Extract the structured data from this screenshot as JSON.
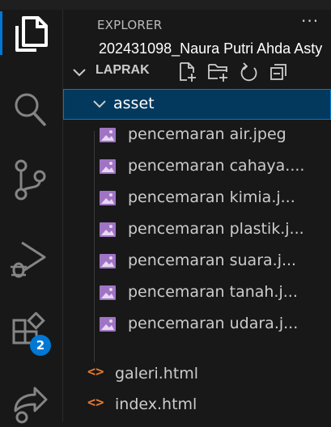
{
  "window": {
    "explorer_title": "EXPLORER",
    "more_label": "···",
    "tooltip": "202431098_Naura Putri Ahda Asty"
  },
  "activity_bar": {
    "items": [
      {
        "icon": "files-icon",
        "active": true
      },
      {
        "icon": "search-icon"
      },
      {
        "icon": "source-control-icon"
      },
      {
        "icon": "run-debug-icon"
      },
      {
        "icon": "extensions-icon",
        "badge": "2"
      },
      {
        "icon": "remote-share-icon"
      }
    ],
    "accent": "#0078d4"
  },
  "explorer": {
    "section_title": "LAPRAK",
    "actions": [
      "new-file-icon",
      "new-folder-icon",
      "refresh-icon",
      "collapse-all-icon"
    ],
    "folder": {
      "name": "asset",
      "expanded": true
    },
    "asset_files": [
      "pencemaran air.jpeg",
      "pencemaran cahaya....",
      "pencemaran kimia.j...",
      "pencemaran plastik.j...",
      "pencemaran suara.j...",
      "pencemaran tanah.j...",
      "pencemaran udara.j..."
    ],
    "root_files": [
      "galeri.html",
      "index.html"
    ],
    "html_icon_glyph": "<>"
  },
  "colors": {
    "selection_bg": "#04395e",
    "html_icon": "#e37933",
    "image_icon": "#a074c4"
  }
}
